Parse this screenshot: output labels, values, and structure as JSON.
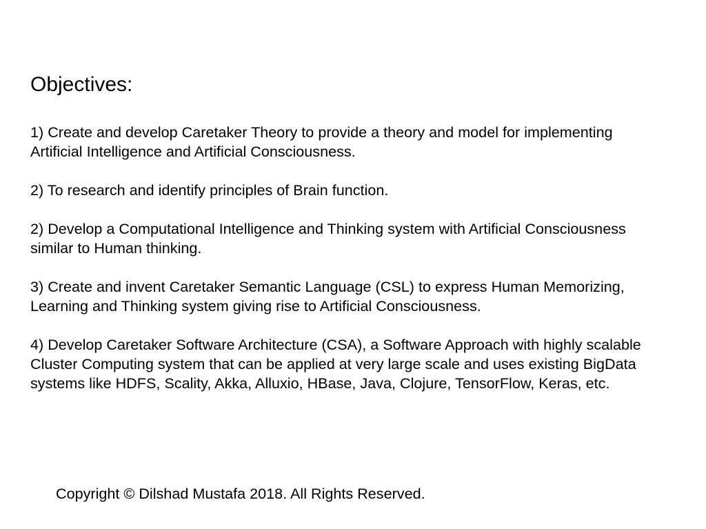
{
  "slide": {
    "title": "Objectives:",
    "paragraphs": [
      {
        "lines": [
          "1) Create and develop Caretaker Theory to provide a theory and model for implementing",
          "Artificial Intelligence and Artificial Consciousness."
        ]
      },
      {
        "lines": [
          "2) To research and identify principles of Brain function."
        ]
      },
      {
        "lines": [
          "2) Develop a Computational Intelligence and Thinking system with Artificial Consciousness",
          "similar to Human thinking."
        ]
      },
      {
        "lines": [
          "3) Create and invent Caretaker Semantic Language (CSL) to express Human Memorizing,",
          "Learning and Thinking system giving rise to Artificial Consciousness."
        ]
      },
      {
        "lines": [
          "4) Develop Caretaker Software Architecture (CSA), a Software Approach with highly scalable",
          "Cluster Computing system that can be applied at very large scale and uses existing BigData",
          "systems like HDFS, Scality, Akka, Alluxio, HBase, Java, Clojure, TensorFlow, Keras, etc."
        ]
      }
    ],
    "copyright": "Copyright © Dilshad Mustafa 2018. All Rights Reserved."
  }
}
